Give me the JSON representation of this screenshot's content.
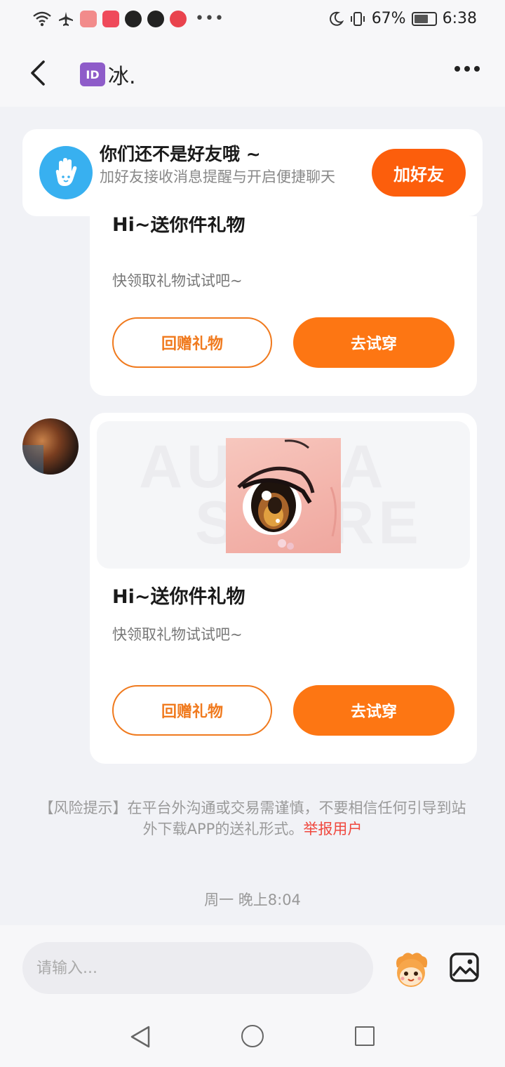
{
  "status_bar": {
    "battery_percent": "67%",
    "battery_level": 0.67,
    "time": "6:38",
    "icons": [
      "wifi-icon",
      "airplane-icon",
      "app-icon",
      "app-icon",
      "tiktok-icon",
      "tiktok-icon",
      "chat-app-icon",
      "more-dots-icon",
      "moon-icon",
      "vibrate-icon",
      "battery-icon"
    ]
  },
  "header": {
    "id_badge": "ID",
    "name": "冰."
  },
  "friend_banner": {
    "title": "你们还不是好友哦 ~",
    "subtitle": "加好友接收消息提醒与开启便捷聊天",
    "button": "加好友"
  },
  "messages": [
    {
      "title": "Hi~送你件礼物",
      "subtitle": "快领取礼物试试吧~",
      "btn_return": "回赠礼物",
      "btn_try": "去试穿"
    },
    {
      "title": "Hi~送你件礼物",
      "subtitle": "快领取礼物试试吧~",
      "btn_return": "回赠礼物",
      "btn_try": "去试穿",
      "watermark_line1": "AUDITA",
      "watermark_line2": "STORE"
    }
  ],
  "risk": {
    "text": "【风险提示】在平台外沟通或交易需谨慎，不要相信任何引导到站外下载APP的送礼形式。",
    "link": "举报用户"
  },
  "timestamp": "周一 晚上8:04",
  "input": {
    "placeholder": "请输入..."
  },
  "colors": {
    "accent": "#fd7613",
    "add_friend": "#fc5e0c",
    "link_red": "#f0483e",
    "background": "#f1f2f6"
  }
}
